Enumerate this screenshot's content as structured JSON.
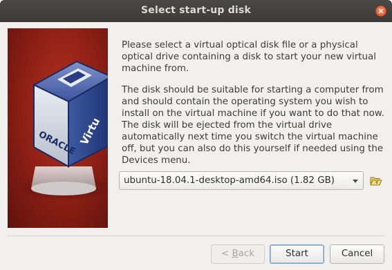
{
  "window": {
    "title": "Select start-up disk"
  },
  "titlebar": {
    "close_icon": "close-icon"
  },
  "side_image": {
    "logo_text_left": "ORACLE",
    "logo_text_right": "Virtu"
  },
  "body": {
    "paragraph1": "Please select a virtual optical disk file or a physical optical drive containing a disk to start your new virtual machine from.",
    "paragraph2": "The disk should be suitable for starting a computer from and should contain the operating system you wish to install on the virtual machine if you want to do that now. The disk will be ejected from the virtual drive automatically next time you switch the virtual machine off, but you can also do this yourself if needed using the Devices menu."
  },
  "disk_selector": {
    "selected_value": "ubuntu-18.04.1-desktop-amd64.iso (1.82 GB)",
    "browse_icon": "folder-open-icon"
  },
  "buttons": {
    "back_prefix": "< ",
    "back_mnemonic": "B",
    "back_rest": "ack",
    "start_label": "Start",
    "cancel_label": "Cancel"
  },
  "colors": {
    "titlebar": "#3c3b37",
    "close_button": "#e0562a",
    "background": "#f1f0ef",
    "side_image_red": "#8a1e14"
  }
}
